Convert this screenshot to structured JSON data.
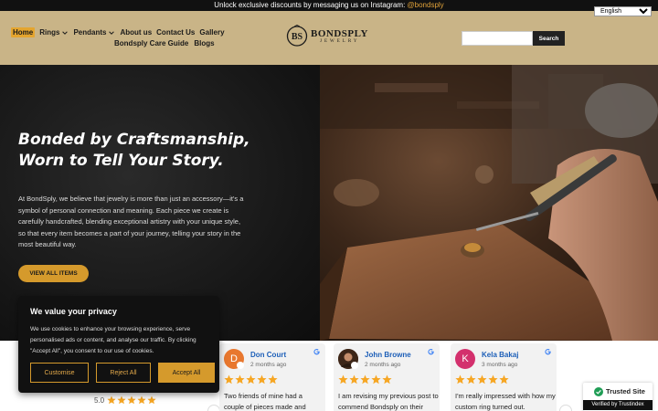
{
  "announcement": {
    "text": "Unlock exclusive discounts by messaging us on Instagram:",
    "handle": "@bondsply"
  },
  "language": {
    "selected": "English"
  },
  "nav": {
    "row1": [
      {
        "label": "Home",
        "active": true,
        "dropdown": false
      },
      {
        "label": "Rings",
        "active": false,
        "dropdown": true
      },
      {
        "label": "Pendants",
        "active": false,
        "dropdown": true
      },
      {
        "label": "About us",
        "active": false,
        "dropdown": false
      },
      {
        "label": "Contact Us",
        "active": false,
        "dropdown": false
      },
      {
        "label": "Gallery",
        "active": false,
        "dropdown": false
      }
    ],
    "row2": [
      {
        "label": "Bondsply Care Guide"
      },
      {
        "label": "Blogs"
      }
    ]
  },
  "logo": {
    "monogram": "BS",
    "name": "BONDSPLY",
    "sub": "JEWELRY"
  },
  "search": {
    "placeholder": "",
    "button": "Search"
  },
  "hero": {
    "title_line1": "Bonded by Craftsmanship,",
    "title_line2": "Worn to Tell Your Story.",
    "body": "At BondSply, we believe that jewelry is more than just an accessory—it's a symbol of personal connection and meaning. Each piece we create is carefully handcrafted, blending exceptional artistry with your unique style, so that every item becomes a part of your journey, telling your story in the most beautiful way.",
    "cta": "VIEW ALL ITEMS"
  },
  "reviews": {
    "summary_score": "5.0",
    "summary_stars": 5,
    "items": [
      {
        "initial": "D",
        "avatar_color": "#e8772e",
        "name": "Don Court",
        "when": "2 months ago",
        "stars": 5,
        "text": "Two friends of mine had a couple of pieces made and"
      },
      {
        "initial": "",
        "avatar_color": "#5b3b2a",
        "name": "John Browne",
        "when": "2 months ago",
        "stars": 5,
        "text": "I am revising my previous post to commend Bondsply on their"
      },
      {
        "initial": "K",
        "avatar_color": "#d3306d",
        "name": "Kela Bakaj",
        "when": "3 months ago",
        "stars": 5,
        "text": "I'm really impressed with how my custom ring turned out."
      }
    ]
  },
  "trust": {
    "title": "Trusted Site",
    "verified": "Verified by Trustindex"
  },
  "cookie": {
    "title": "We value your privacy",
    "body": "We use cookies to enhance your browsing experience, serve personalised ads or content, and analyse our traffic. By clicking \"Accept All\", you consent to our use of cookies.",
    "customise": "Customise",
    "reject": "Reject All",
    "accept": "Accept All"
  },
  "colors": {
    "header_bg": "#c9b487",
    "accent": "#d59a2c",
    "star": "#f6a623",
    "link_blue": "#1d5fb8"
  }
}
